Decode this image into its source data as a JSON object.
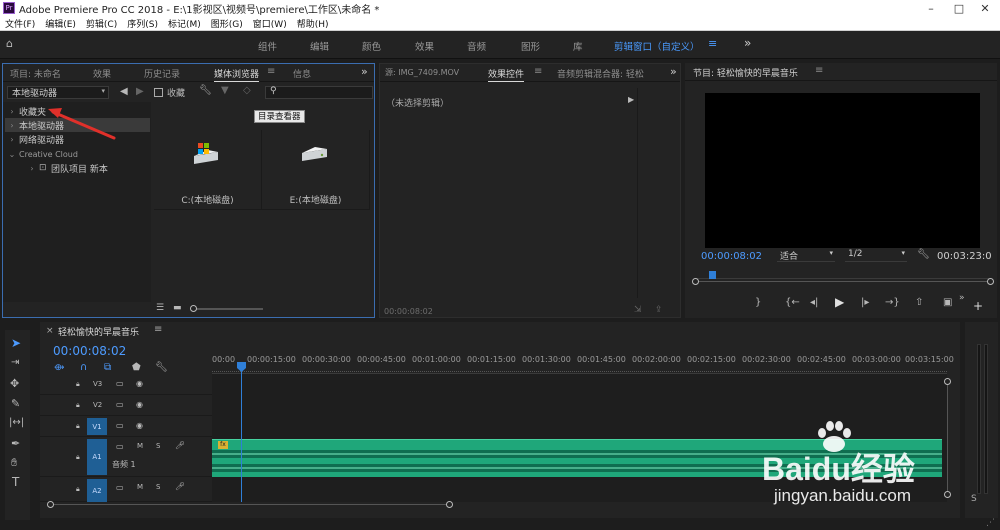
{
  "app": {
    "title": "Adobe Premiere Pro CC 2018 - E:\\1影视区\\视频号\\premiere\\工作区\\未命名 *",
    "icon_text": "Pr"
  },
  "menubar": [
    "文件(F)",
    "编辑(E)",
    "剪辑(C)",
    "序列(S)",
    "标记(M)",
    "图形(G)",
    "窗口(W)",
    "帮助(H)"
  ],
  "workspaces": [
    "组件",
    "编辑",
    "颜色",
    "效果",
    "音频",
    "图形",
    "库",
    "剪辑窗口（自定义）"
  ],
  "project_panel": {
    "tabs": [
      "项目: 未命名",
      "效果",
      "历史记录",
      "媒体浏览器",
      "信息"
    ],
    "active_tab": "媒体浏览器",
    "location_select": "本地驱动器",
    "checkbox_label": "收藏",
    "tooltip": "目录查看器",
    "tree": [
      {
        "label": "收藏夹",
        "level": 0
      },
      {
        "label": "本地驱动器",
        "level": 0
      },
      {
        "label": "网络驱动器",
        "level": 0
      },
      {
        "label": "Creative Cloud",
        "level": 0,
        "open": true
      },
      {
        "label": "团队项目 新本",
        "level": 1
      }
    ],
    "drives": [
      {
        "label": "C:(本地磁盘)",
        "icon": "windows-drive-icon"
      },
      {
        "label": "E:(本地磁盘)",
        "icon": "hard-drive-icon"
      }
    ]
  },
  "source_panel": {
    "tabs": [
      "源: IMG_7409.MOV",
      "效果控件",
      "音频剪辑混合器: 轻松"
    ],
    "active_tab": "效果控件",
    "no_clip": "（未选择剪辑）",
    "timecode": "00:00:08:02"
  },
  "program_panel": {
    "title": "节目: 轻松愉快的早晨音乐",
    "timecode": "00:00:08:02",
    "fit_select": "适合",
    "resolution_select": "1/2",
    "duration": "00:03:23:0",
    "playhead_fraction": 0.04
  },
  "timeline": {
    "sequence_name": "轻松愉快的早晨音乐",
    "timecode": "00:00:08:02",
    "ruler": [
      "00:00",
      "00:00:15:00",
      "00:00:30:00",
      "00:00:45:00",
      "00:01:00:00",
      "00:01:15:00",
      "00:01:30:00",
      "00:01:45:00",
      "00:02:00:00",
      "00:02:15:00",
      "00:02:30:00",
      "00:02:45:00",
      "00:03:00:00",
      "00:03:15:00"
    ],
    "video_tracks": [
      "V3",
      "V2",
      "V1"
    ],
    "audio_tracks": [
      "A1",
      "A2"
    ],
    "audio_track_name": "音频 1",
    "track_buttons": [
      "M",
      "S"
    ],
    "clip_fx": "fx"
  },
  "watermark": {
    "logo": "Baidu经验",
    "url": "jingyan.baidu.com"
  },
  "colors": {
    "accent": "#2f7fd8",
    "clip_green": "#1fa77a",
    "panel_bg": "#232323"
  }
}
